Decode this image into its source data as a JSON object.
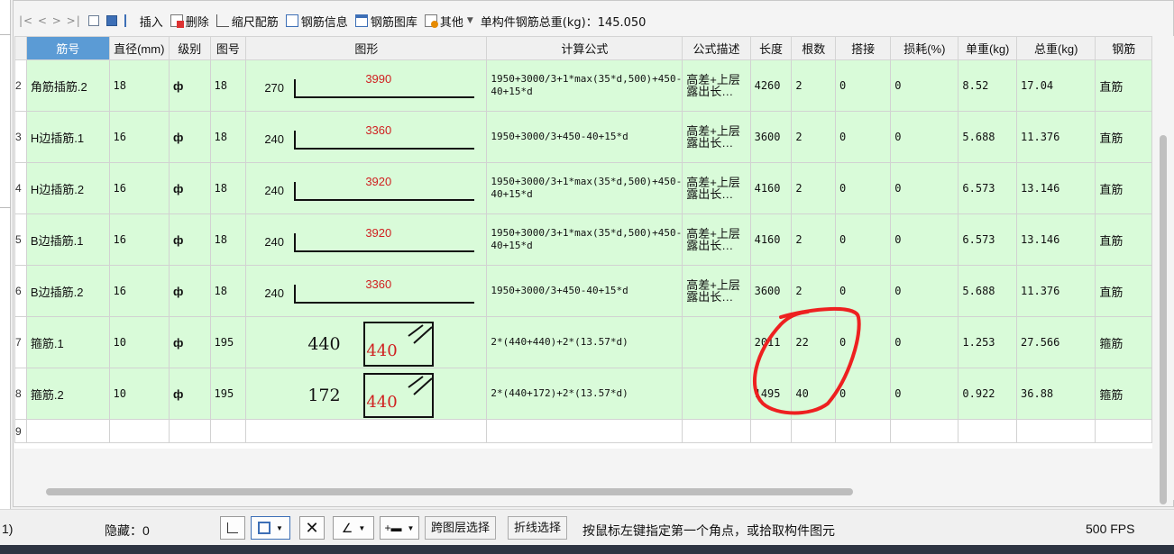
{
  "toolbar": {
    "nav": "|< < > >|",
    "insert": "插入",
    "delete": "删除",
    "scale": "缩尺配筋",
    "info": "钢筋信息",
    "library": "钢筋图库",
    "other": "其他",
    "total": "单构件钢筋总重(kg)：145.050"
  },
  "columns": [
    "筋号",
    "直径(mm)",
    "级别",
    "图号",
    "图形",
    "计算公式",
    "公式描述",
    "长度",
    "根数",
    "搭接",
    "损耗(%)",
    "单重(kg)",
    "总重(kg)",
    "钢筋"
  ],
  "grade_symbol": "ф",
  "rows": [
    {
      "n": "2",
      "name": "角筋插筋.2",
      "dia": "18",
      "fig": "18",
      "shape": {
        "type": "bent",
        "left": "270",
        "len": "3990"
      },
      "formula": "1950+3000/3+1*max(35*d,500)+450-40+15*d",
      "desc": "高差+上层露出长…",
      "length": "4260",
      "count": "2",
      "lap": "0",
      "loss": "0",
      "unit": "8.52",
      "total": "17.04",
      "kind": "直筋"
    },
    {
      "n": "3",
      "name": "H边插筋.1",
      "dia": "16",
      "fig": "18",
      "shape": {
        "type": "bent",
        "left": "240",
        "len": "3360"
      },
      "formula": "1950+3000/3+450-40+15*d",
      "desc": "高差+上层露出长…",
      "length": "3600",
      "count": "2",
      "lap": "0",
      "loss": "0",
      "unit": "5.688",
      "total": "11.376",
      "kind": "直筋"
    },
    {
      "n": "4",
      "name": "H边插筋.2",
      "dia": "16",
      "fig": "18",
      "shape": {
        "type": "bent",
        "left": "240",
        "len": "3920"
      },
      "formula": "1950+3000/3+1*max(35*d,500)+450-40+15*d",
      "desc": "高差+上层露出长…",
      "length": "4160",
      "count": "2",
      "lap": "0",
      "loss": "0",
      "unit": "6.573",
      "total": "13.146",
      "kind": "直筋"
    },
    {
      "n": "5",
      "name": "B边插筋.1",
      "dia": "16",
      "fig": "18",
      "shape": {
        "type": "bent",
        "left": "240",
        "len": "3920"
      },
      "formula": "1950+3000/3+1*max(35*d,500)+450-40+15*d",
      "desc": "高差+上层露出长…",
      "length": "4160",
      "count": "2",
      "lap": "0",
      "loss": "0",
      "unit": "6.573",
      "total": "13.146",
      "kind": "直筋"
    },
    {
      "n": "6",
      "name": "B边插筋.2",
      "dia": "16",
      "fig": "18",
      "shape": {
        "type": "bent",
        "left": "240",
        "len": "3360"
      },
      "formula": "1950+3000/3+450-40+15*d",
      "desc": "高差+上层露出长…",
      "length": "3600",
      "count": "2",
      "lap": "0",
      "loss": "0",
      "unit": "5.688",
      "total": "11.376",
      "kind": "直筋"
    },
    {
      "n": "7",
      "name": "箍筋.1",
      "dia": "10",
      "fig": "195",
      "shape": {
        "type": "stirrup",
        "left": "440",
        "len": "440"
      },
      "formula": "2*(440+440)+2*(13.57*d)",
      "desc": "",
      "length": "2011",
      "count": "22",
      "lap": "0",
      "loss": "0",
      "unit": "1.253",
      "total": "27.566",
      "kind": "箍筋"
    },
    {
      "n": "8",
      "name": "箍筋.2",
      "dia": "10",
      "fig": "195",
      "shape": {
        "type": "stirrup",
        "left": "172",
        "len": "440"
      },
      "formula": "2*(440+172)+2*(13.57*d)",
      "desc": "",
      "length": "1495",
      "count": "40",
      "lap": "0",
      "loss": "0",
      "unit": "0.922",
      "total": "36.88",
      "kind": "箍筋"
    }
  ],
  "empty_row": "9",
  "status": {
    "left": "1)",
    "hidden": "隐藏：0",
    "cross_layer": "跨图层选择",
    "polyline": "折线选择",
    "hint": "按鼠标左键指定第一个角点，或拾取构件图元",
    "fps": "500 FPS"
  }
}
